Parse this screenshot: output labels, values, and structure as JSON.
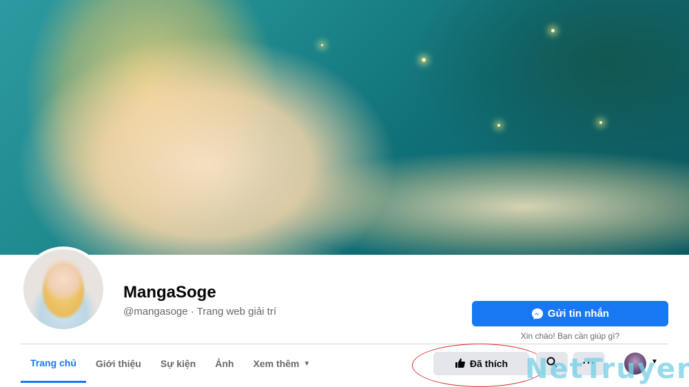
{
  "page": {
    "name": "MangaSoge",
    "handle_line": "@mangasoge · Trang web giải trí"
  },
  "actions": {
    "message_label": "Gửi tin nhắn",
    "greeting": "Xin chào! Bạn cần giúp gì?",
    "liked_label": "Đã thích",
    "more_label": "···"
  },
  "tabs": [
    {
      "label": "Trang chủ",
      "active": true
    },
    {
      "label": "Giới thiệu"
    },
    {
      "label": "Sự kiện"
    },
    {
      "label": "Ảnh"
    },
    {
      "label": "Xem thêm"
    }
  ],
  "watermark": "NetTruyen",
  "colors": {
    "primary": "#1877f2",
    "secondary_button": "#e4e6eb",
    "highlight_ellipse": "#d9262b",
    "watermark": "#78d0e6"
  },
  "icons": [
    "messenger-icon",
    "thumbs-up-icon",
    "search-icon",
    "chevron-down-icon"
  ]
}
